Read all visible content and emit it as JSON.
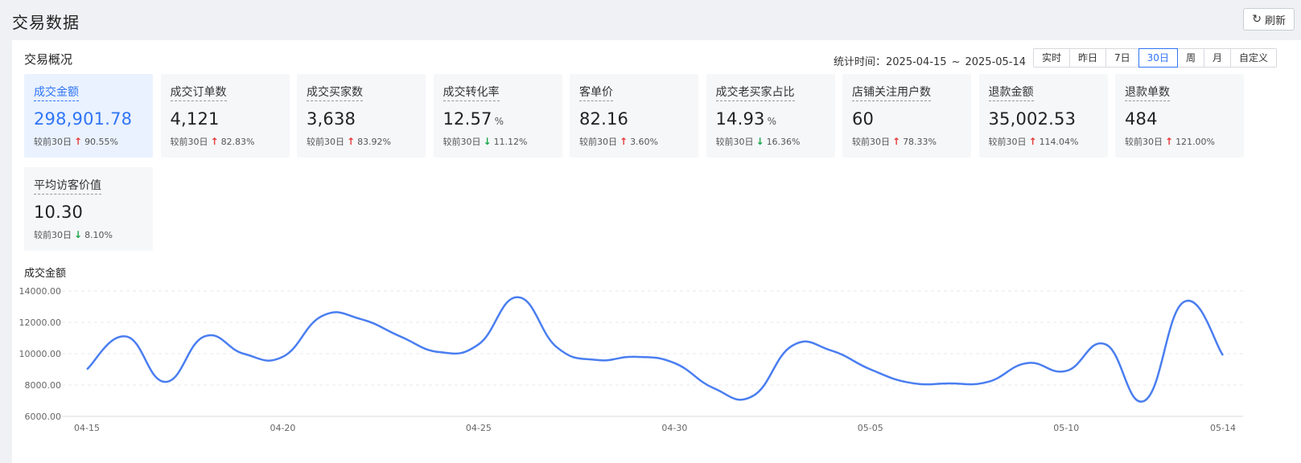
{
  "header": {
    "title": "交易数据",
    "refresh_label": "刷新",
    "refresh_icon": "refresh-icon"
  },
  "overview": {
    "title": "交易概况",
    "range_label": "统计时间：",
    "range_start": "2025-04-15",
    "range_sep": "~",
    "range_end": "2025-05-14",
    "tabs": [
      {
        "label": "实时"
      },
      {
        "label": "昨日"
      },
      {
        "label": "7日"
      },
      {
        "label": "30日",
        "active": true
      },
      {
        "label": "周"
      },
      {
        "label": "月"
      },
      {
        "label": "自定义"
      }
    ]
  },
  "cards": [
    {
      "label": "成交金额",
      "value": "298,901.78",
      "unit": "",
      "cmp_label": "较前30日",
      "direction": "up",
      "change": "90.55%",
      "active": true
    },
    {
      "label": "成交订单数",
      "value": "4,121",
      "unit": "",
      "cmp_label": "较前30日",
      "direction": "up",
      "change": "82.83%"
    },
    {
      "label": "成交买家数",
      "value": "3,638",
      "unit": "",
      "cmp_label": "较前30日",
      "direction": "up",
      "change": "83.92%"
    },
    {
      "label": "成交转化率",
      "value": "12.57",
      "unit": "%",
      "cmp_label": "较前30日",
      "direction": "down",
      "change": "11.12%"
    },
    {
      "label": "客单价",
      "value": "82.16",
      "unit": "",
      "cmp_label": "较前30日",
      "direction": "up",
      "change": "3.60%"
    },
    {
      "label": "成交老买家占比",
      "value": "14.93",
      "unit": "%",
      "cmp_label": "较前30日",
      "direction": "down",
      "change": "16.36%"
    },
    {
      "label": "店铺关注用户数",
      "value": "60",
      "unit": "",
      "cmp_label": "较前30日",
      "direction": "up",
      "change": "78.33%"
    },
    {
      "label": "退款金额",
      "value": "35,002.53",
      "unit": "",
      "cmp_label": "较前30日",
      "direction": "up",
      "change": "114.04%"
    },
    {
      "label": "退款单数",
      "value": "484",
      "unit": "",
      "cmp_label": "较前30日",
      "direction": "up",
      "change": "121.00%"
    },
    {
      "label": "平均访客价值",
      "value": "10.30",
      "unit": "",
      "cmp_label": "较前30日",
      "direction": "down",
      "change": "8.10%"
    }
  ],
  "colors": {
    "accent": "#2f75f5",
    "line": "#4a7ef0",
    "up": "#e83a3a",
    "down": "#1aa54a"
  },
  "chart_data": {
    "type": "line",
    "title": "成交金额",
    "ylim": [
      6000,
      14000
    ],
    "ytick_labels": [
      "14000.00",
      "12000.00",
      "10000.00",
      "8000.00",
      "6000.00"
    ],
    "yticks": [
      14000,
      12000,
      10000,
      8000,
      6000
    ],
    "xtick_labels": [
      "04-15",
      "04-20",
      "04-25",
      "04-30",
      "05-05",
      "05-10",
      "05-14"
    ],
    "xtick_index": [
      0,
      5,
      10,
      15,
      20,
      25,
      29
    ],
    "grid": "horizontal-dashed",
    "x": [
      "04-15",
      "04-16",
      "04-17",
      "04-18",
      "04-19",
      "04-20",
      "04-21",
      "04-22",
      "04-23",
      "04-24",
      "04-25",
      "04-26",
      "04-27",
      "04-28",
      "04-29",
      "04-30",
      "05-01",
      "05-02",
      "05-03",
      "05-04",
      "05-05",
      "05-06",
      "05-07",
      "05-08",
      "05-09",
      "05-10",
      "05-11",
      "05-12",
      "05-13",
      "05-14"
    ],
    "series": [
      {
        "values": [
          9000,
          11100,
          8200,
          11100,
          10000,
          9800,
          12400,
          12200,
          11100,
          10100,
          10600,
          13600,
          10400,
          9600,
          9800,
          9400,
          7800,
          7300,
          10500,
          10200,
          9000,
          8150,
          8100,
          8200,
          9400,
          8900,
          10600,
          7000,
          13300,
          9900
        ]
      }
    ]
  }
}
